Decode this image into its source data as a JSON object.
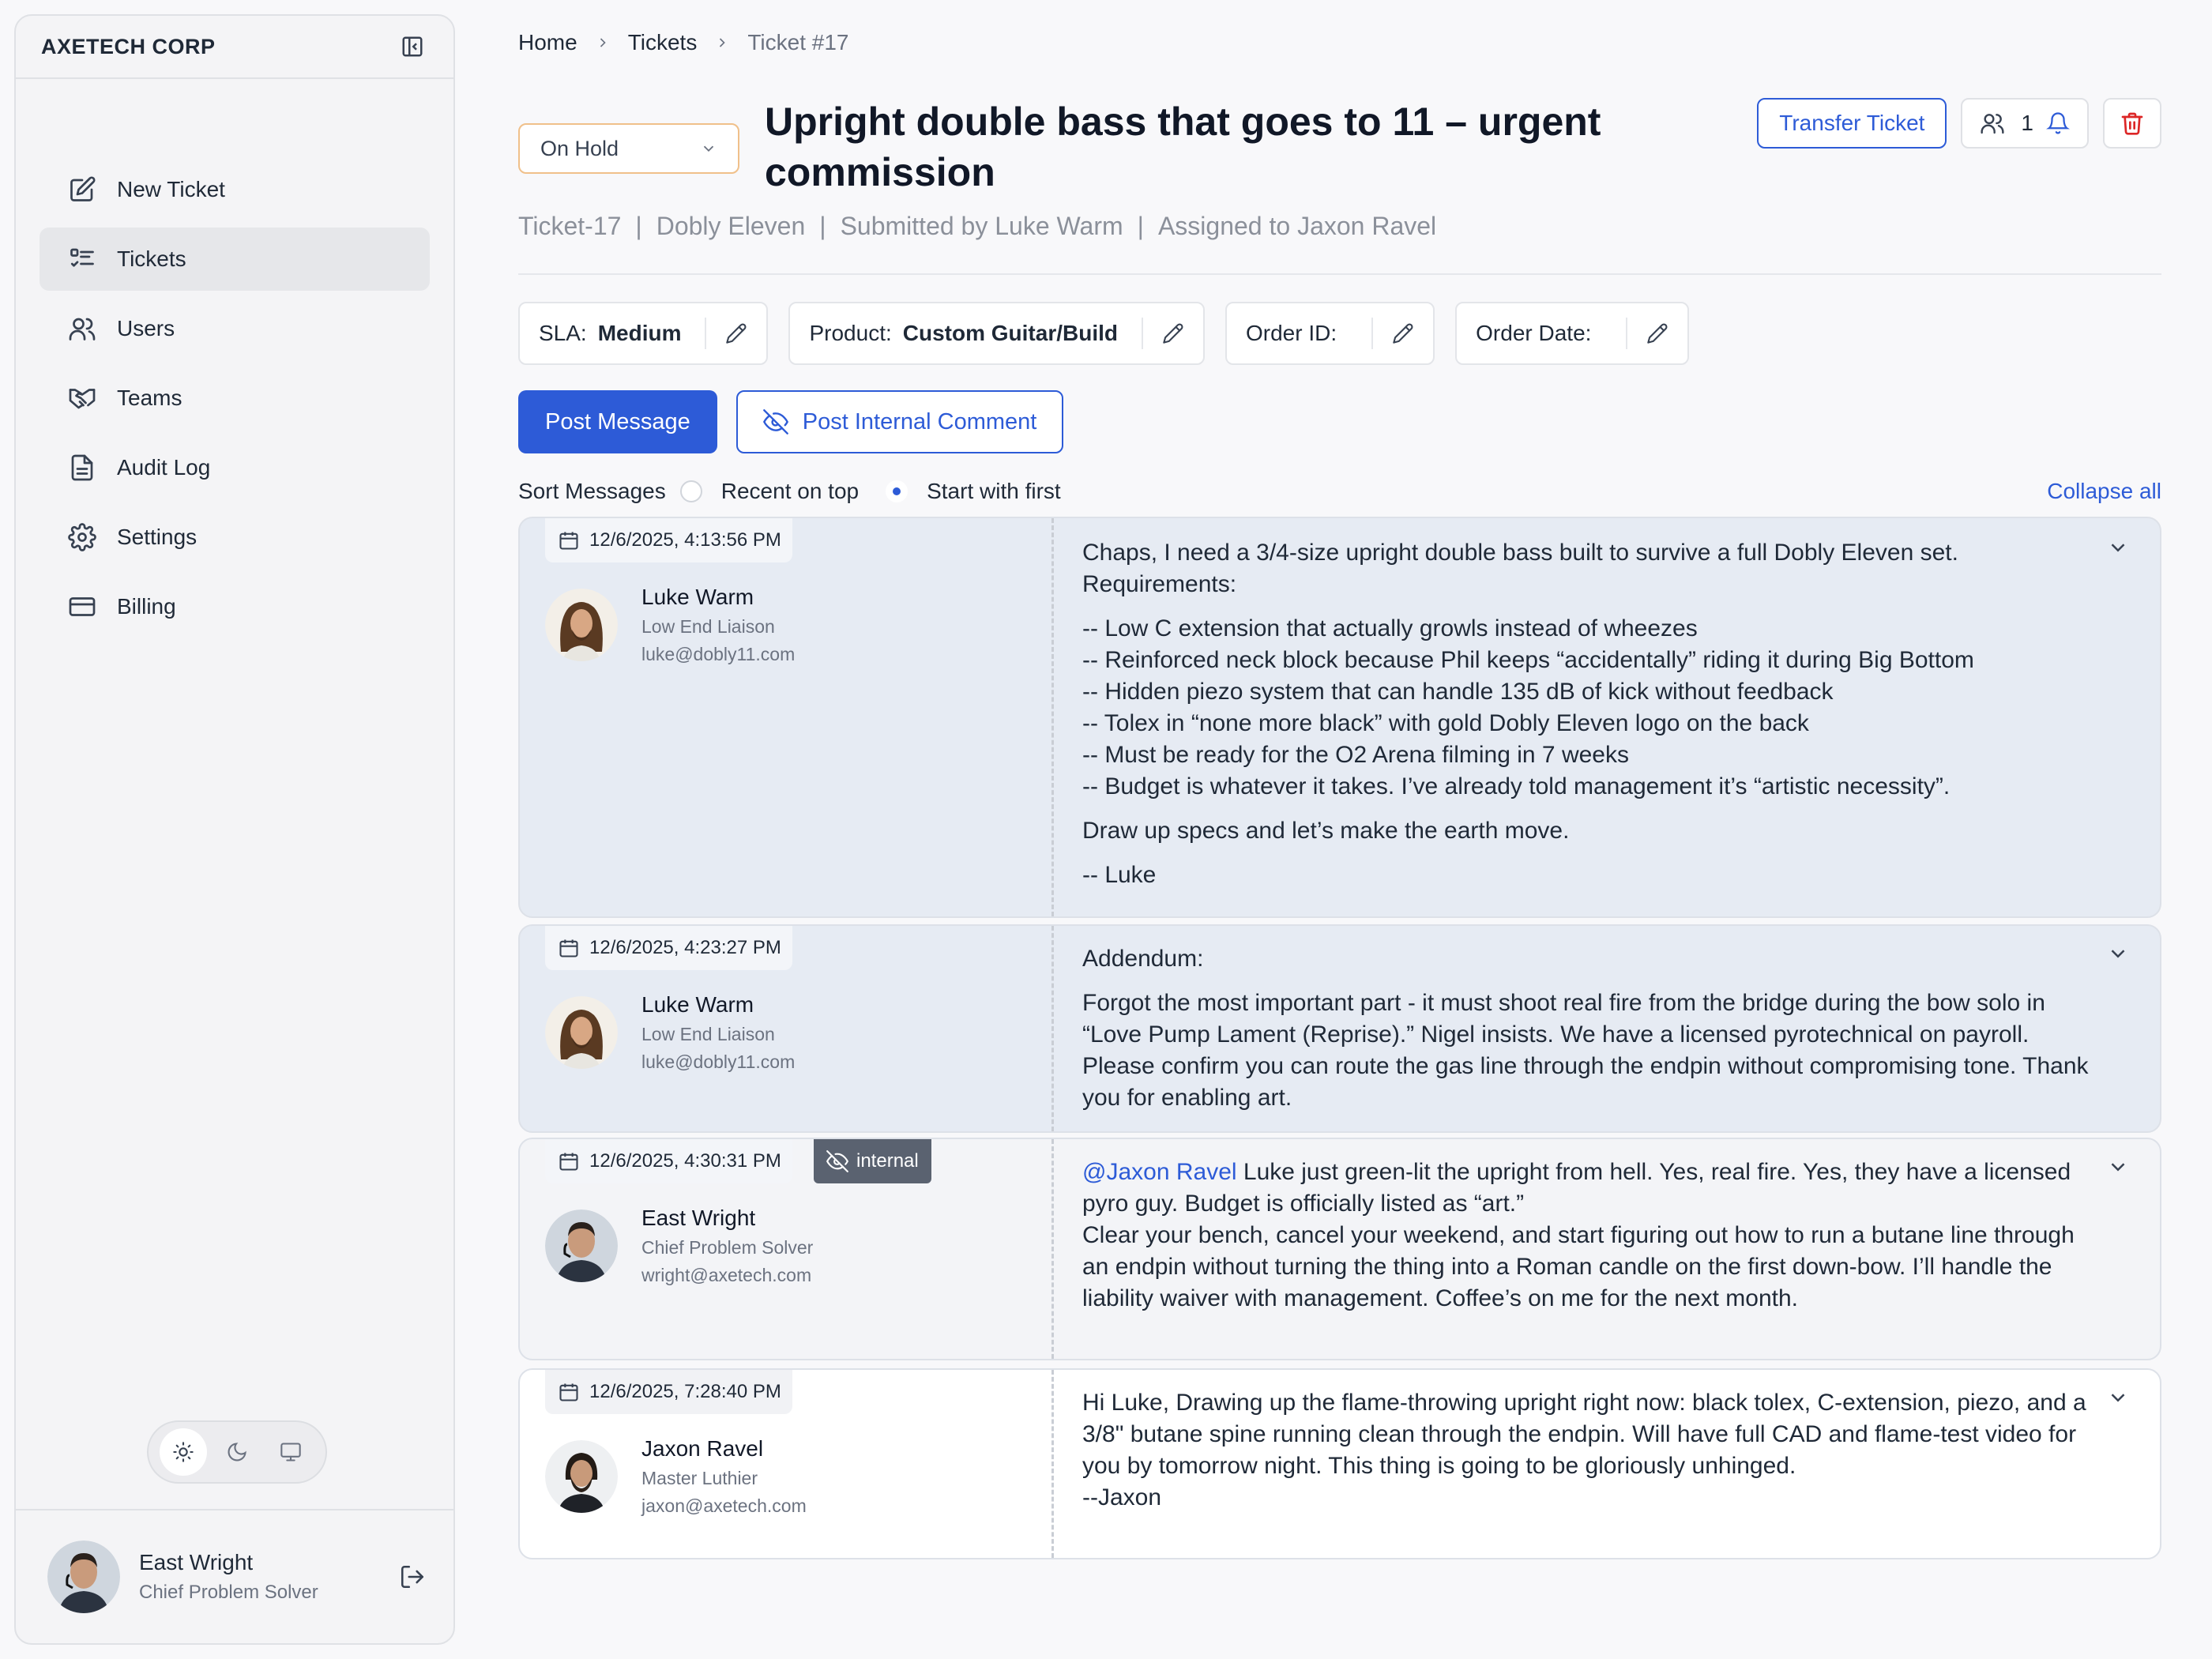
{
  "sidebar": {
    "brand": "AXETECH CORP",
    "items": [
      {
        "label": "New Ticket",
        "icon": "pencil-square-icon"
      },
      {
        "label": "Tickets",
        "icon": "list-icon",
        "active": true
      },
      {
        "label": "Users",
        "icon": "users-icon"
      },
      {
        "label": "Teams",
        "icon": "handshake-icon"
      },
      {
        "label": "Audit Log",
        "icon": "document-icon"
      },
      {
        "label": "Settings",
        "icon": "gear-icon"
      },
      {
        "label": "Billing",
        "icon": "credit-card-icon"
      }
    ],
    "theme": {
      "active": "light",
      "options": [
        "sun-icon",
        "moon-icon",
        "monitor-icon"
      ]
    },
    "user": {
      "name": "East Wright",
      "role": "Chief Problem Solver"
    }
  },
  "breadcrumb": [
    "Home",
    "Tickets",
    "Ticket #17"
  ],
  "ticket": {
    "status": "On Hold",
    "title": "Upright double bass that goes to 11 – urgent commission",
    "meta": {
      "id": "Ticket-17",
      "company": "Dobly Eleven",
      "submitted": "Submitted by Luke Warm",
      "assigned": "Assigned to Jaxon Ravel",
      "separator": "|"
    },
    "actions": {
      "transfer": "Transfer Ticket",
      "watchers": "1"
    },
    "fields": [
      {
        "label": "SLA:",
        "value": "Medium"
      },
      {
        "label": "Product:",
        "value": "Custom Guitar/Build"
      },
      {
        "label": "Order ID:",
        "value": ""
      },
      {
        "label": "Order Date:",
        "value": ""
      }
    ]
  },
  "compose": {
    "post": "Post Message",
    "internal": "Post Internal Comment"
  },
  "sort": {
    "label": "Sort Messages",
    "recent": "Recent on top",
    "first": "Start with first",
    "selected": "first",
    "collapse_all": "Collapse all"
  },
  "messages": [
    {
      "timestamp": "12/6/2025, 4:13:56 PM",
      "author": {
        "name": "Luke Warm",
        "role": "Low End Liaison",
        "email": "luke@dobly11.com"
      },
      "paragraphs": [
        "Chaps, I need a 3/4-size upright double bass built to survive a full Dobly Eleven set.",
        "Requirements:",
        "-- Low C extension that actually growls instead of wheezes",
        "-- Reinforced neck block because Phil keeps “accidentally” riding it during Big Bottom",
        "-- Hidden piezo system that can handle 135 dB of kick without feedback",
        "-- Tolex in “none more black” with gold Dobly Eleven logo on the back",
        "-- Must be ready for the O2 Arena filming in 7 weeks",
        "-- Budget is whatever it takes. I’ve already told management it’s “artistic necessity”.",
        "Draw up specs and let’s make the earth move.",
        "-- Luke"
      ]
    },
    {
      "timestamp": "12/6/2025, 4:23:27 PM",
      "author": {
        "name": "Luke Warm",
        "role": "Low End Liaison",
        "email": "luke@dobly11.com"
      },
      "paragraphs": [
        "Addendum:",
        "Forgot the most important part - it must shoot real fire from the bridge during the bow solo in “Love Pump Lament (Reprise).” Nigel insists. We have a licensed pyrotechnical on payroll. Please confirm you can route the gas line through the endpin without compromising tone. Thank you for enabling art."
      ]
    },
    {
      "timestamp": "12/6/2025, 4:30:31 PM",
      "internal_label": "internal",
      "author": {
        "name": "East Wright",
        "role": "Chief Problem Solver",
        "email": "wright@axetech.com"
      },
      "mention": "@Jaxon Ravel",
      "paragraphs": [
        " Luke just green-lit the upright from hell. Yes, real fire. Yes, they have a licensed pyro guy. Budget is officially listed as “art.”",
        "Clear your bench, cancel your weekend, and start figuring out how to run a butane line through an endpin without turning the thing into a Roman candle on the first down-bow. I’ll handle the liability waiver with management. Coffee’s on me for the next month."
      ]
    },
    {
      "timestamp": "12/6/2025, 7:28:40 PM",
      "author": {
        "name": "Jaxon Ravel",
        "role": "Master Luthier",
        "email": "jaxon@axetech.com"
      },
      "paragraphs": [
        "Hi Luke, Drawing up the flame-throwing upright right now: black tolex, C-extension, piezo, and a 3/8\" butane spine running clean through the endpin. Will have full CAD and flame-test video for you by tomorrow night. This thing is going to be gloriously unhinged.",
        "--Jaxon"
      ]
    }
  ],
  "colors": {
    "accent": "#2d5bd7",
    "danger": "#dc2626",
    "status_border": "#f0c08a",
    "message_bg": "#e6ebf3"
  }
}
